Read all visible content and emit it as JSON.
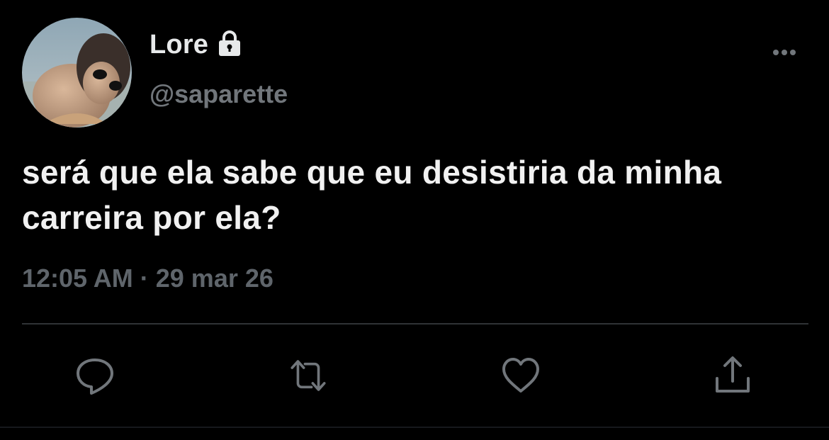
{
  "user": {
    "display_name": "Lore",
    "handle": "@saparette",
    "avatar_icon": "avatar-photo",
    "protected_icon": "lock-icon"
  },
  "tweet": {
    "text": "será que ela sabe que eu desistiria da minha carreira por ela?",
    "time": "12:05 AM",
    "separator": "·",
    "date": "29 mar 26"
  },
  "actions": [
    {
      "name": "reply",
      "icon": "comment-icon"
    },
    {
      "name": "retweet",
      "icon": "retweet-icon"
    },
    {
      "name": "like",
      "icon": "heart-icon"
    },
    {
      "name": "share",
      "icon": "share-icon"
    }
  ],
  "colors": {
    "background": "#000000",
    "primary_text": "#e7e9ea",
    "secondary_text": "#71767b",
    "divider": "#2f3336"
  }
}
